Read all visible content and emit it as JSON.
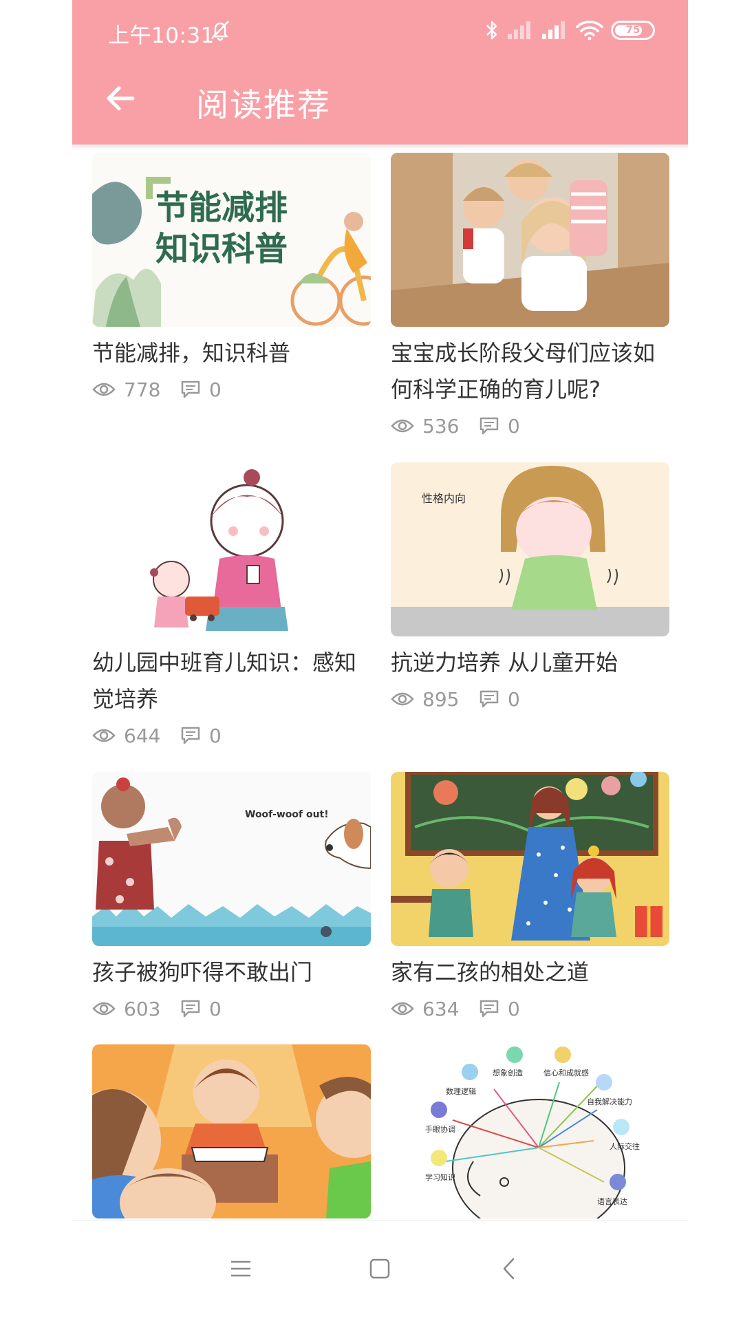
{
  "status_bar": {
    "time": "上午10:31",
    "battery_level": "75"
  },
  "header": {
    "title": "阅读推荐"
  },
  "articles": [
    {
      "title": "节能减排，知识科普",
      "views": "778",
      "comments": "0",
      "image_text": [
        "节能减排",
        "知识科普"
      ]
    },
    {
      "title": "宝宝成长阶段父母们应该如何科学正确的育儿呢?",
      "views": "536",
      "comments": "0"
    },
    {
      "title": "幼儿园中班育儿知识：感知觉培养",
      "views": "644",
      "comments": "0"
    },
    {
      "title": "抗逆力培养 从儿童开始",
      "views": "895",
      "comments": "0",
      "image_text": "性格内向"
    },
    {
      "title": "孩子被狗吓得不敢出门",
      "views": "603",
      "comments": "0",
      "image_text": "Woof-woof out!"
    },
    {
      "title": "家有二孩的相处之道",
      "views": "634",
      "comments": "0"
    },
    {
      "title": "",
      "views": "",
      "comments": ""
    },
    {
      "title": "",
      "views": "",
      "comments": "",
      "image_text": [
        "想象创造",
        "信心和成就感",
        "数理逻辑",
        "自我解决能力",
        "手眼协调",
        "人际交往",
        "学习知识",
        "语言表达"
      ]
    }
  ],
  "colors": {
    "header": "#f9a0a7",
    "title_text": "#333333",
    "meta_text": "#999999"
  },
  "icons": {
    "back": "arrow-left-icon",
    "views": "eye-icon",
    "comments": "comment-icon",
    "nav_menu": "menu-icon",
    "nav_home": "square-icon",
    "nav_back": "chevron-left-icon"
  }
}
